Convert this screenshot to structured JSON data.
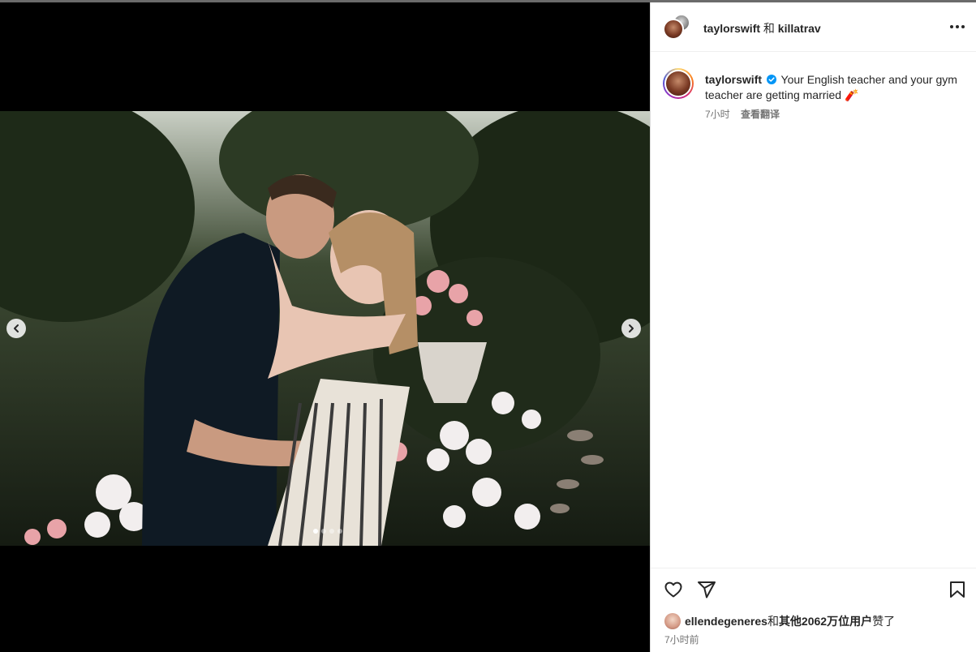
{
  "post": {
    "header": {
      "author": "taylorswift",
      "conjunction": "和",
      "coauthor": "killatrav",
      "more_icon": "more-horizontal-icon"
    },
    "caption": {
      "username": "taylorswift",
      "verified_icon": "verified-badge-icon",
      "text": "Your English teacher and your gym teacher are getting married 🧨",
      "time": "7小时",
      "translate": "查看翻译"
    },
    "media": {
      "prev_icon": "chevron-left-icon",
      "next_icon": "chevron-right-icon",
      "slide_count": 4,
      "active_slide": 1
    },
    "actions": {
      "like_icon": "heart-icon",
      "share_icon": "paper-plane-icon",
      "save_icon": "bookmark-icon"
    },
    "likes": {
      "user": "ellendegeneres",
      "joiner": "和",
      "others": "其他2062万位用户",
      "suffix": "赞了"
    },
    "timestamp": "7小时前"
  },
  "colors": {
    "verified": "#0095f6",
    "text_primary": "#262626",
    "text_secondary": "#737373",
    "divider": "#efefef"
  }
}
